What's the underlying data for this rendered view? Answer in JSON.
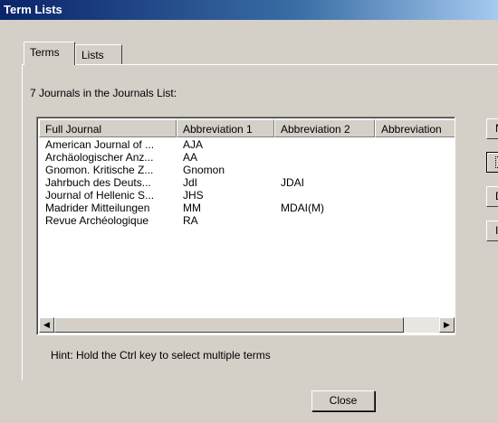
{
  "window": {
    "title": "Term Lists"
  },
  "tabs": [
    {
      "label": "Terms"
    },
    {
      "label": "Lists"
    }
  ],
  "count_label": "7 Journals in the Journals List:",
  "list": {
    "columns": [
      "Full Journal",
      "Abbreviation 1",
      "Abbreviation 2",
      "Abbreviation"
    ],
    "rows": [
      [
        "American Journal of ...",
        "AJA",
        "",
        ""
      ],
      [
        "Archäologischer Anz...",
        "AA",
        "",
        ""
      ],
      [
        "Gnomon. Kritische Z...",
        "Gnomon",
        "",
        ""
      ],
      [
        "Jahrbuch des Deuts...",
        "JdI",
        "JDAI",
        ""
      ],
      [
        "Journal of Hellenic S...",
        "JHS",
        "",
        ""
      ],
      [
        "Madrider Mitteilungen",
        "MM",
        "MDAI(M)",
        ""
      ],
      [
        "Revue Archéologique",
        "RA",
        "",
        ""
      ]
    ]
  },
  "side_buttons": [
    {
      "label": "N"
    },
    {
      "label": ""
    },
    {
      "label": "D"
    },
    {
      "label": "I"
    }
  ],
  "hint": "Hint: Hold the Ctrl key to select multiple terms",
  "close_label": "Close"
}
